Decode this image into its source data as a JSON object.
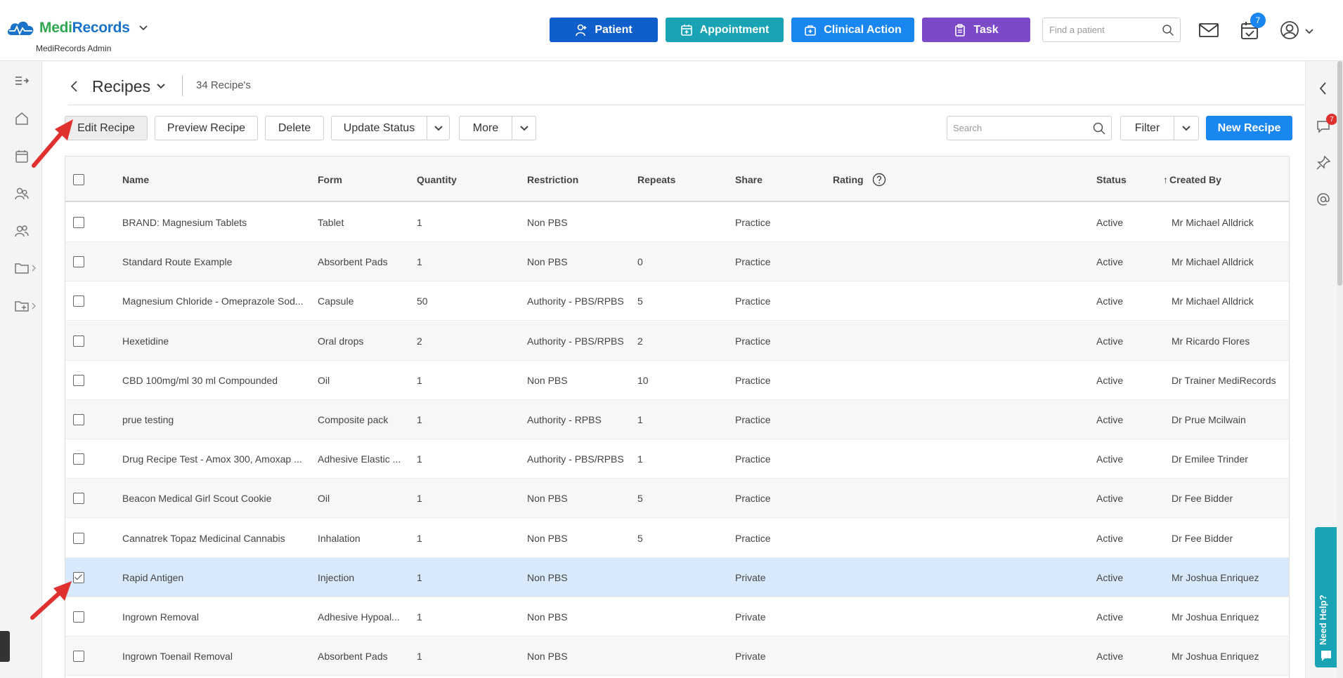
{
  "app": {
    "logo_medi": "Medi",
    "logo_records": "Records",
    "subtitle": "MediRecords Admin"
  },
  "header": {
    "patient_label": "Patient",
    "appointment_label": "Appointment",
    "clinical_label": "Clinical Action",
    "task_label": "Task",
    "find_placeholder": "Find a patient",
    "calendar_badge": "7"
  },
  "page": {
    "title": "Recipes",
    "count": "34 Recipe's"
  },
  "toolbar": {
    "edit_label": "Edit Recipe",
    "preview_label": "Preview Recipe",
    "delete_label": "Delete",
    "update_status_label": "Update Status",
    "more_label": "More",
    "search_placeholder": "Search",
    "filter_label": "Filter",
    "new_recipe_label": "New Recipe"
  },
  "right_sidebar": {
    "chat_badge": "7",
    "need_help_label": "Need Help?"
  },
  "colors": {
    "patient": "#0f5ec9",
    "appointment": "#1aa3b4",
    "clinical": "#1a86f0",
    "task": "#7c49c9",
    "selected_row": "#d7e9fb"
  },
  "table": {
    "columns": {
      "name": "Name",
      "form": "Form",
      "quantity": "Quantity",
      "restriction": "Restriction",
      "repeats": "Repeats",
      "share": "Share",
      "rating": "Rating",
      "status": "Status",
      "created_by": "Created By",
      "sort_arrow": "↑"
    },
    "rows": [
      {
        "name": "BRAND: Magnesium Tablets",
        "form": "Tablet",
        "quantity": "1",
        "restriction": "Non PBS",
        "repeats": "",
        "share": "Practice",
        "status": "Active",
        "created_by": "Mr Michael Alldrick",
        "checked": false
      },
      {
        "name": "Standard Route Example",
        "form": "Absorbent Pads",
        "quantity": "1",
        "restriction": "Non PBS",
        "repeats": "0",
        "share": "Practice",
        "status": "Active",
        "created_by": "Mr Michael Alldrick",
        "checked": false
      },
      {
        "name": "Magnesium Chloride - Omeprazole Sod...",
        "form": "Capsule",
        "quantity": "50",
        "restriction": "Authority - PBS/RPBS",
        "repeats": "5",
        "share": "Practice",
        "status": "Active",
        "created_by": "Mr Michael Alldrick",
        "checked": false
      },
      {
        "name": "Hexetidine",
        "form": "Oral drops",
        "quantity": "2",
        "restriction": "Authority - PBS/RPBS",
        "repeats": "2",
        "share": "Practice",
        "status": "Active",
        "created_by": "Mr Ricardo Flores",
        "checked": false
      },
      {
        "name": "CBD 100mg/ml 30 ml Compounded",
        "form": "Oil",
        "quantity": "1",
        "restriction": "Non PBS",
        "repeats": "10",
        "share": "Practice",
        "status": "Active",
        "created_by": "Dr Trainer MediRecords",
        "checked": false
      },
      {
        "name": "prue testing",
        "form": "Composite pack",
        "quantity": "1",
        "restriction": "Authority - RPBS",
        "repeats": "1",
        "share": "Practice",
        "status": "Active",
        "created_by": "Dr Prue Mcilwain",
        "checked": false
      },
      {
        "name": "Drug Recipe Test - Amox 300, Amoxap ...",
        "form": "Adhesive Elastic ...",
        "quantity": "1",
        "restriction": "Authority - PBS/RPBS",
        "repeats": "1",
        "share": "Practice",
        "status": "Active",
        "created_by": "Dr Emilee Trinder",
        "checked": false
      },
      {
        "name": "Beacon Medical Girl Scout Cookie",
        "form": "Oil",
        "quantity": "1",
        "restriction": "Non PBS",
        "repeats": "5",
        "share": "Practice",
        "status": "Active",
        "created_by": "Dr Fee Bidder",
        "checked": false
      },
      {
        "name": "Cannatrek Topaz Medicinal Cannabis",
        "form": "Inhalation",
        "quantity": "1",
        "restriction": "Non PBS",
        "repeats": "5",
        "share": "Practice",
        "status": "Active",
        "created_by": "Dr Fee Bidder",
        "checked": false
      },
      {
        "name": "Rapid Antigen",
        "form": "Injection",
        "quantity": "1",
        "restriction": "Non PBS",
        "repeats": "",
        "share": "Private",
        "status": "Active",
        "created_by": "Mr Joshua Enriquez",
        "checked": true
      },
      {
        "name": "Ingrown Removal",
        "form": "Adhesive Hypoal...",
        "quantity": "1",
        "restriction": "Non PBS",
        "repeats": "",
        "share": "Private",
        "status": "Active",
        "created_by": "Mr Joshua Enriquez",
        "checked": false
      },
      {
        "name": "Ingrown Toenail Removal",
        "form": "Absorbent Pads",
        "quantity": "1",
        "restriction": "Non PBS",
        "repeats": "",
        "share": "Private",
        "status": "Active",
        "created_by": "Mr Joshua Enriquez",
        "checked": false
      }
    ]
  }
}
